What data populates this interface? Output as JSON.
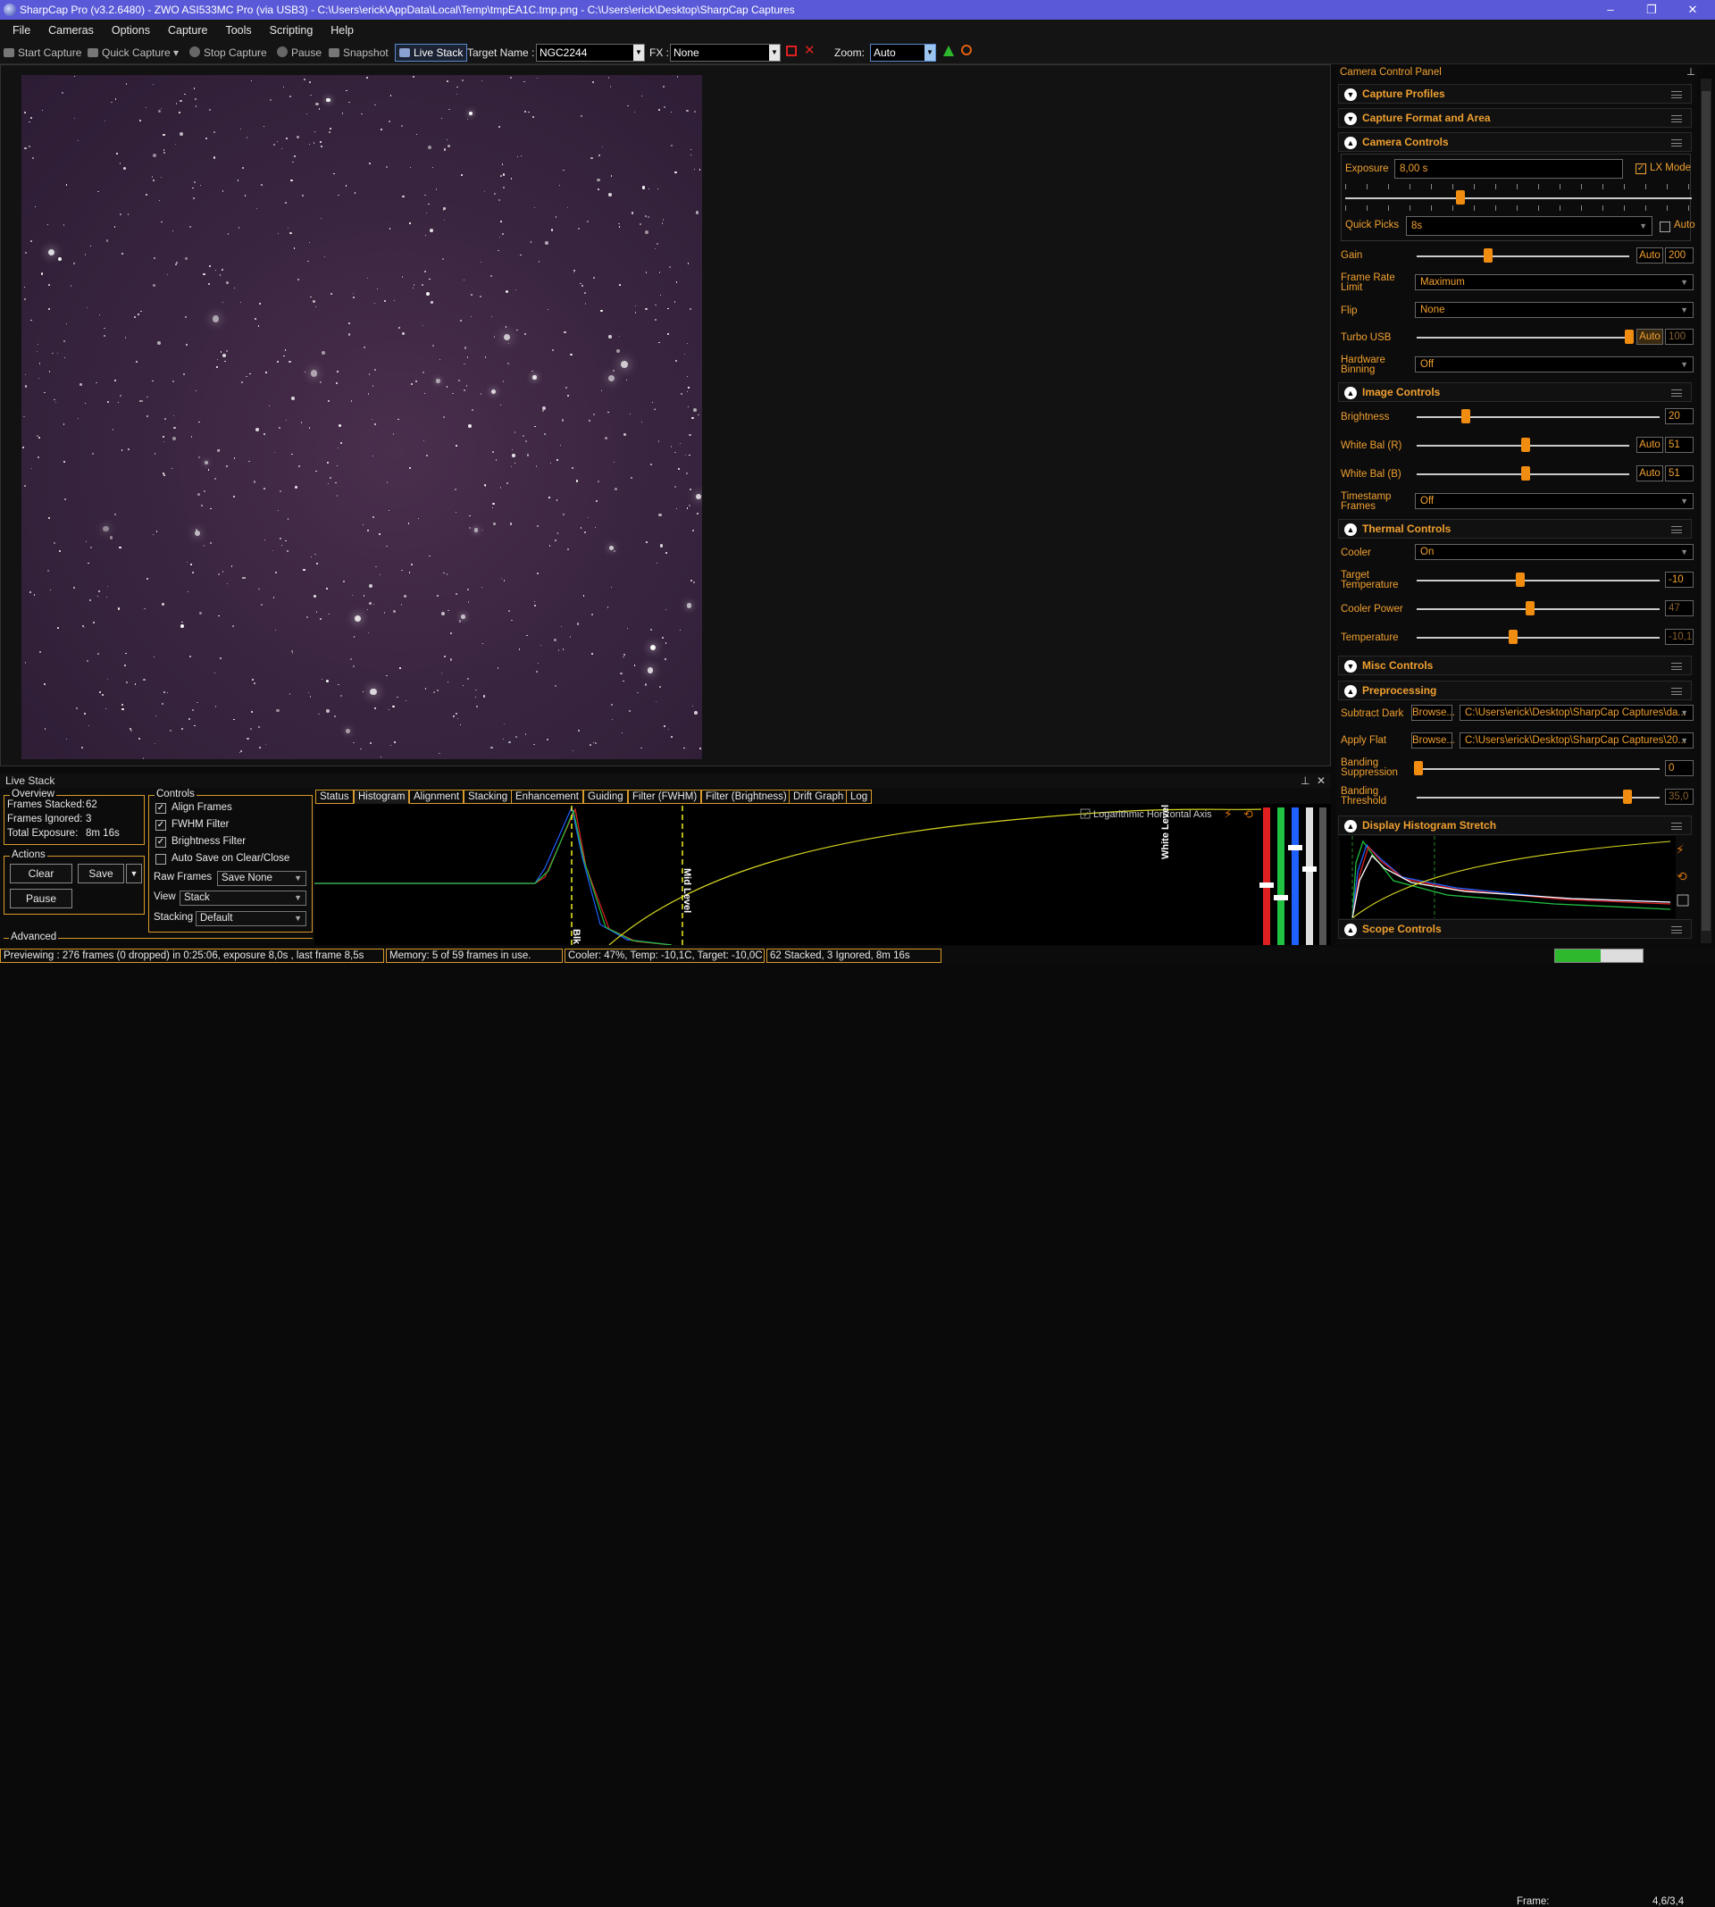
{
  "window": {
    "title": "SharpCap Pro (v3.2.6480) - ZWO ASI533MC Pro (via USB3) - C:\\Users\\erick\\AppData\\Local\\Temp\\tmpEA1C.tmp.png - C:\\Users\\erick\\Desktop\\SharpCap Captures",
    "minimize": "–",
    "maximize": "❐",
    "close": "✕"
  },
  "menu": [
    "File",
    "Cameras",
    "Options",
    "Capture",
    "Tools",
    "Scripting",
    "Help"
  ],
  "toolbar": {
    "start_capture": "Start Capture",
    "quick_capture": "Quick Capture",
    "stop_capture": "Stop Capture",
    "pause": "Pause",
    "snapshot": "Snapshot",
    "live_stack": "Live Stack",
    "target_label": "Target Name :",
    "target_value": "NGC2244",
    "fx_label": "FX :",
    "fx_value": "None",
    "zoom_label": "Zoom:",
    "zoom_value": "Auto"
  },
  "live_stack": {
    "title": "Live Stack",
    "overview": {
      "title": "Overview",
      "frames_stacked_label": "Frames Stacked:",
      "frames_stacked": "62",
      "frames_ignored_label": "Frames Ignored:",
      "frames_ignored": "3",
      "total_exposure_label": "Total Exposure:",
      "total_exposure": "8m 16s"
    },
    "actions": {
      "title": "Actions",
      "clear": "Clear",
      "save": "Save",
      "pause": "Pause"
    },
    "advanced": "Advanced",
    "controls": {
      "title": "Controls",
      "align_frames": "Align Frames",
      "fwhm_filter": "FWHM Filter",
      "brightness_filter": "Brightness Filter",
      "auto_save": "Auto Save on Clear/Close",
      "raw_frames_label": "Raw Frames",
      "raw_frames_value": "Save None",
      "view_label": "View",
      "view_value": "Stack",
      "stacking_label": "Stacking",
      "stacking_value": "Default"
    },
    "tabs": [
      "Status",
      "Histogram",
      "Alignment",
      "Stacking",
      "Enhancement",
      "Guiding",
      "Filter (FWHM)",
      "Filter (Brightness)",
      "Drift Graph",
      "Log"
    ],
    "active_tab": "Histogram",
    "histogram": {
      "log_axis_label": "Logarithmic Horizontal Axis",
      "black_label": "Blk",
      "mid_label": "Mid Level",
      "white_label": "White Level"
    }
  },
  "status_bar": {
    "preview": "Previewing : 276 frames (0 dropped) in 0:25:06, exposure 8,0s , last frame 8,5s",
    "memory": "Memory: 5 of 59 frames in use.",
    "cooler": "Cooler: 47%, Temp: -10,1C, Target: -10,0C",
    "stack": "62 Stacked, 3 Ignored, 8m 16s",
    "frame_label": "Frame:",
    "frame_progress": 0.52,
    "frame_value": "4,6/3,4"
  },
  "camera_panel": {
    "title": "Camera Control Panel",
    "sections": {
      "capture_profiles": "Capture Profiles",
      "capture_format": "Capture Format and Area",
      "camera_controls": "Camera Controls",
      "image_controls": "Image Controls",
      "thermal_controls": "Thermal Controls",
      "misc_controls": "Misc Controls",
      "preprocessing": "Preprocessing",
      "display_stretch": "Display Histogram Stretch",
      "scope_controls": "Scope Controls"
    },
    "exposure_label": "Exposure",
    "exposure_value": "8,00 s",
    "lx_mode": "LX Mode",
    "quick_picks_label": "Quick Picks",
    "quick_picks_value": "8s",
    "auto": "Auto",
    "gain_label": "Gain",
    "gain_value": "200",
    "frame_rate_label": "Frame Rate Limit",
    "frame_rate_value": "Maximum",
    "flip_label": "Flip",
    "flip_value": "None",
    "turbo_label": "Turbo USB",
    "turbo_value": "100",
    "binning_label": "Hardware Binning",
    "binning_value": "Off",
    "brightness_label": "Brightness",
    "brightness_value": "20",
    "wb_r_label": "White Bal (R)",
    "wb_r_value": "51",
    "wb_b_label": "White Bal (B)",
    "wb_b_value": "51",
    "timestamp_label": "Timestamp Frames",
    "timestamp_value": "Off",
    "cooler_label": "Cooler",
    "cooler_value": "On",
    "target_temp_label": "Target Temperature",
    "target_temp_value": "-10",
    "cooler_power_label": "Cooler Power",
    "cooler_power_value": "47",
    "temperature_label": "Temperature",
    "temperature_value": "-10,1",
    "subtract_dark_label": "Subtract Dark",
    "subtract_dark_value": "C:\\Users\\erick\\Desktop\\SharpCap Captures\\da...",
    "apply_flat_label": "Apply Flat",
    "apply_flat_value": "C:\\Users\\erick\\Desktop\\SharpCap Captures\\20...",
    "browse": "Browse...",
    "banding_supp_label": "Banding Suppression",
    "banding_supp_value": "0",
    "banding_thresh_label": "Banding Threshold",
    "banding_thresh_value": "35,0"
  }
}
